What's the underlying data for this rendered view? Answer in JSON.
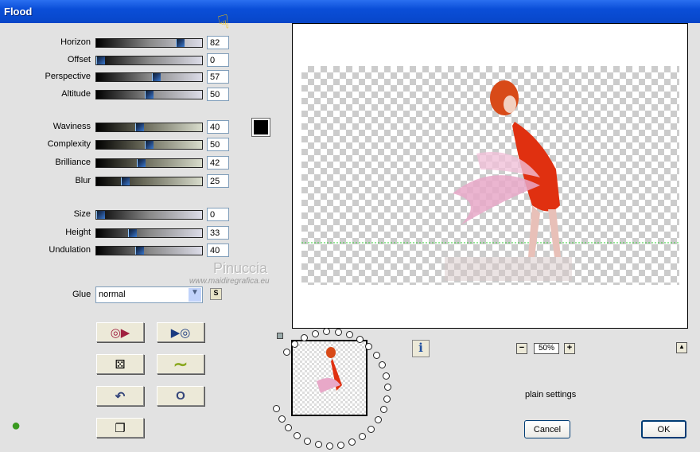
{
  "window": {
    "title": "Flood"
  },
  "sliders": [
    {
      "label": "Horizon",
      "value": "82",
      "pct": 82,
      "style": "gray"
    },
    {
      "label": "Offset",
      "value": "0",
      "pct": 0,
      "style": "gray"
    },
    {
      "label": "Perspective",
      "value": "57",
      "pct": 57,
      "style": "gray"
    },
    {
      "label": "Altitude",
      "value": "50",
      "pct": 50,
      "style": "gray"
    },
    {
      "label": "Waviness",
      "value": "40",
      "pct": 40,
      "style": "green"
    },
    {
      "label": "Complexity",
      "value": "50",
      "pct": 50,
      "style": "green"
    },
    {
      "label": "Brilliance",
      "value": "42",
      "pct": 42,
      "style": "green"
    },
    {
      "label": "Blur",
      "value": "25",
      "pct": 25,
      "style": "green"
    },
    {
      "label": "Size",
      "value": "0",
      "pct": 0,
      "style": "gray"
    },
    {
      "label": "Height",
      "value": "33",
      "pct": 33,
      "style": "gray"
    },
    {
      "label": "Undulation",
      "value": "40",
      "pct": 40,
      "style": "gray"
    }
  ],
  "color_swatch": "#000000",
  "glue": {
    "label": "Glue",
    "value": "normal",
    "s_button": "S"
  },
  "watermark": {
    "name": "Pinuccia",
    "url": "www.maidiregrafica.eu"
  },
  "zoom": {
    "minus": "−",
    "value": "50%",
    "plus": "+"
  },
  "info_icon": "i",
  "status": "plain settings",
  "buttons": {
    "cancel": "Cancel",
    "ok": "OK",
    "collapse": "▲"
  }
}
